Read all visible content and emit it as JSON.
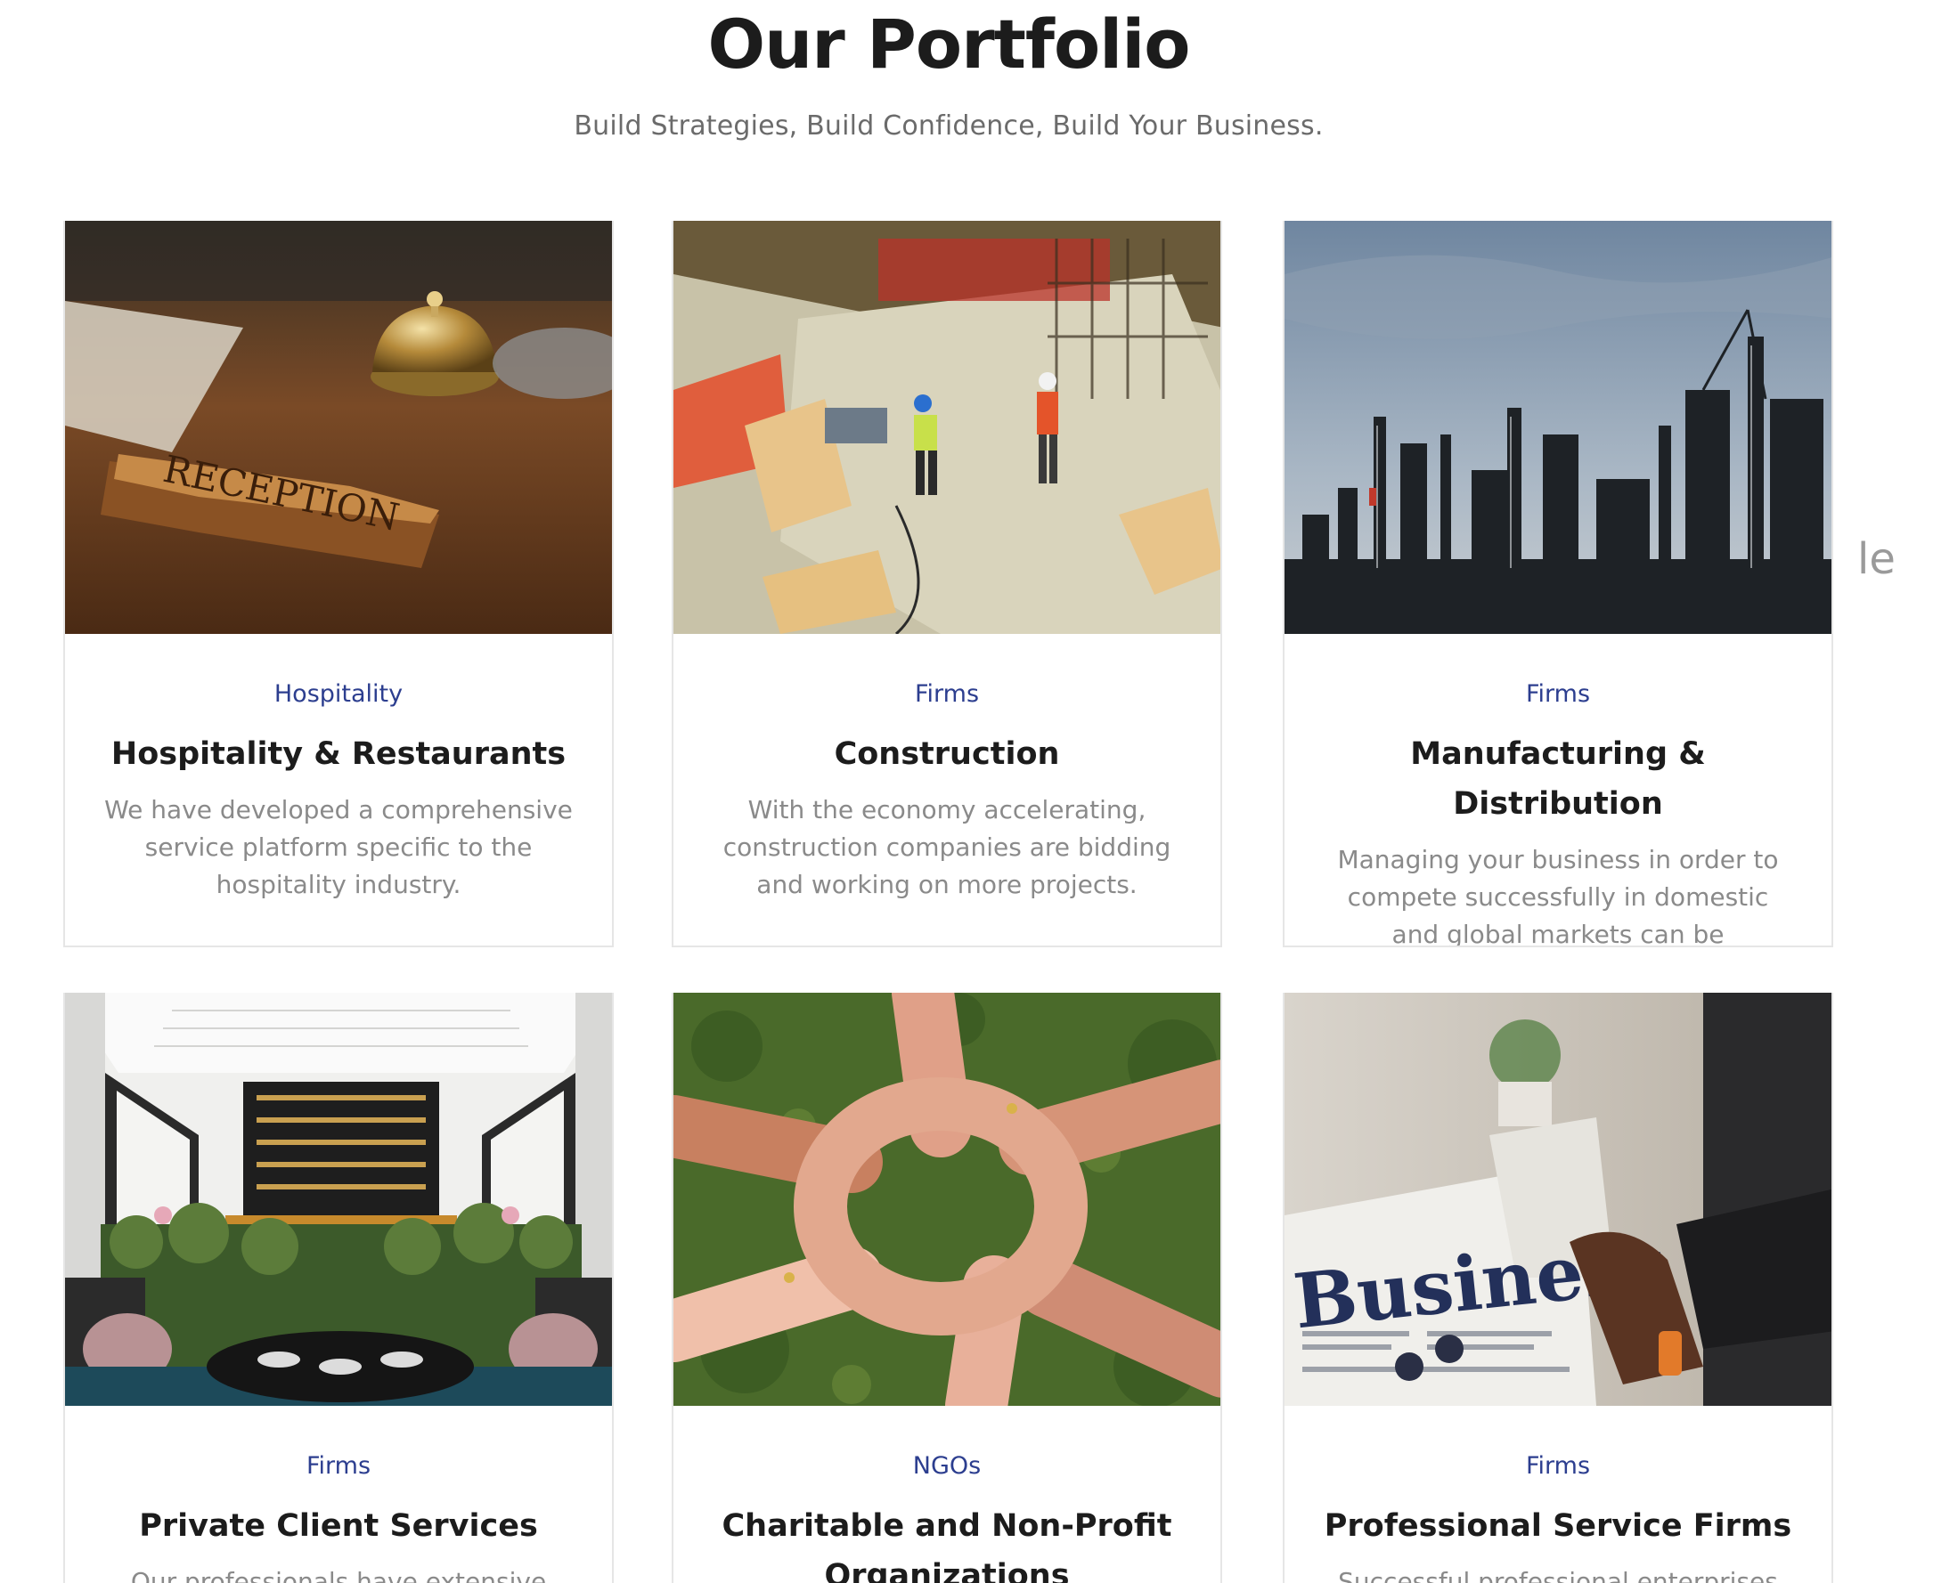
{
  "header": {
    "title": "Our Portfolio",
    "subtitle": "Build Strategies, Build Confidence, Build Your Business."
  },
  "cards": [
    {
      "category": "Hospitality",
      "title": "Hospitality & Restaurants",
      "description": "We have developed a comprehensive service platform specific to the hospitality industry.",
      "image": "reception-bell-photo",
      "image_text": "RECEPTION"
    },
    {
      "category": "Firms",
      "title": "Construction",
      "description": "With the economy accelerating, construction companies are bidding and working on more projects.",
      "image": "construction-site-photo"
    },
    {
      "category": "Firms",
      "title": "Manufacturing & Distribution",
      "description": "Managing your business in order to compete successfully in domestic and global markets can be challenging.",
      "image": "refinery-photo"
    },
    {
      "category": "Firms",
      "title": "Private Client Services",
      "description": "Our professionals have extensive",
      "image": "restaurant-interior-photo"
    },
    {
      "category": "NGOs",
      "title": "Charitable and Non-Profit Organizations",
      "description": "",
      "image": "joined-hands-photo"
    },
    {
      "category": "Firms",
      "title": "Professional Service Firms",
      "description": "Successful professional enterprises",
      "image": "business-newspaper-photo",
      "image_text": "Business"
    }
  ],
  "edge_fragment": "le",
  "colors": {
    "category": "#2c3e8f",
    "title": "#1c1c1c",
    "description": "#8a8a8a",
    "border": "#e6e6e6"
  }
}
